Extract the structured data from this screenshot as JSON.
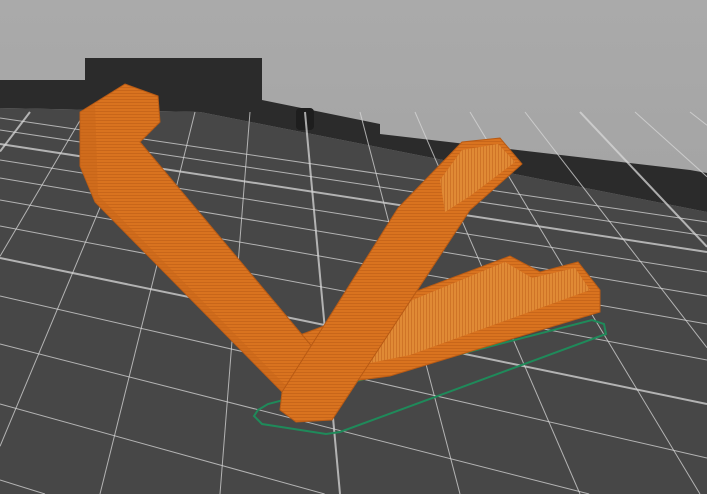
{
  "viewport": {
    "view": "3d-preview",
    "colors": {
      "background_top": "#a9a9a9",
      "background_bottom": "#9c9c9c",
      "bed_frame": "#2b2b2b",
      "bed_plate": "#474747",
      "grid_line": "#d8d8d8",
      "model": "#d9731f",
      "model_shade": "#b85a14",
      "model_highlight": "#e8953e",
      "skirt": "#1f8a5a",
      "top_layer": "#c02020"
    }
  }
}
